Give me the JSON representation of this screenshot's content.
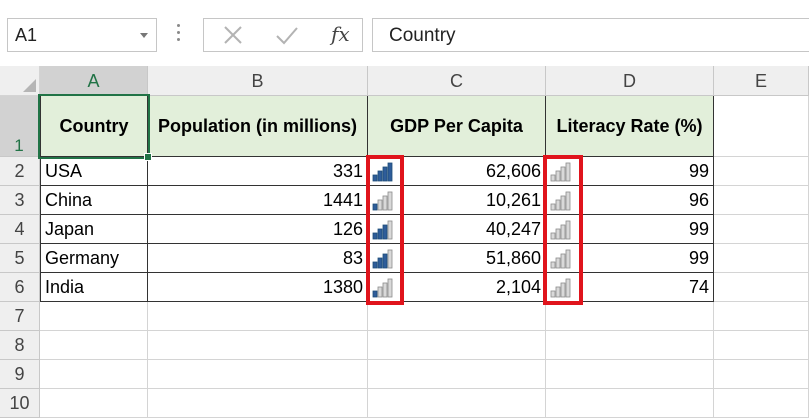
{
  "formula_bar": {
    "name_box_value": "A1",
    "cancel_icon": "x-icon",
    "enter_icon": "checkmark-icon",
    "fx_label": "fx",
    "formula_value": "Country"
  },
  "columns": [
    "A",
    "B",
    "C",
    "D",
    "E"
  ],
  "rows": [
    "1",
    "2",
    "3",
    "4",
    "5",
    "6",
    "7",
    "8",
    "9",
    "10"
  ],
  "table": {
    "headers": [
      "Country",
      "Population (in millions)",
      "GDP Per Capita",
      "Literacy Rate (%)"
    ],
    "rows": [
      {
        "country": "USA",
        "population": "331",
        "gdp": "62,606",
        "literacy": "99"
      },
      {
        "country": "China",
        "population": "1441",
        "gdp": "10,261",
        "literacy": "96"
      },
      {
        "country": "Japan",
        "population": "126",
        "gdp": "40,247",
        "literacy": "99"
      },
      {
        "country": "Germany",
        "population": "83",
        "gdp": "51,860",
        "literacy": "99"
      },
      {
        "country": "India",
        "population": "1380",
        "gdp": "2,104",
        "literacy": "74"
      }
    ]
  },
  "icon_sets": {
    "icon_name": "signal-bars-icon",
    "filled_color": "#2e5d9a",
    "empty_color": "#a6a6a6",
    "gdp_filled_bars": [
      4,
      1,
      3,
      3,
      1
    ],
    "literacy_filled_bars": [
      0,
      0,
      0,
      0,
      0
    ]
  },
  "highlight_color": "#e0141c",
  "header_fill_color": "#e2efda"
}
